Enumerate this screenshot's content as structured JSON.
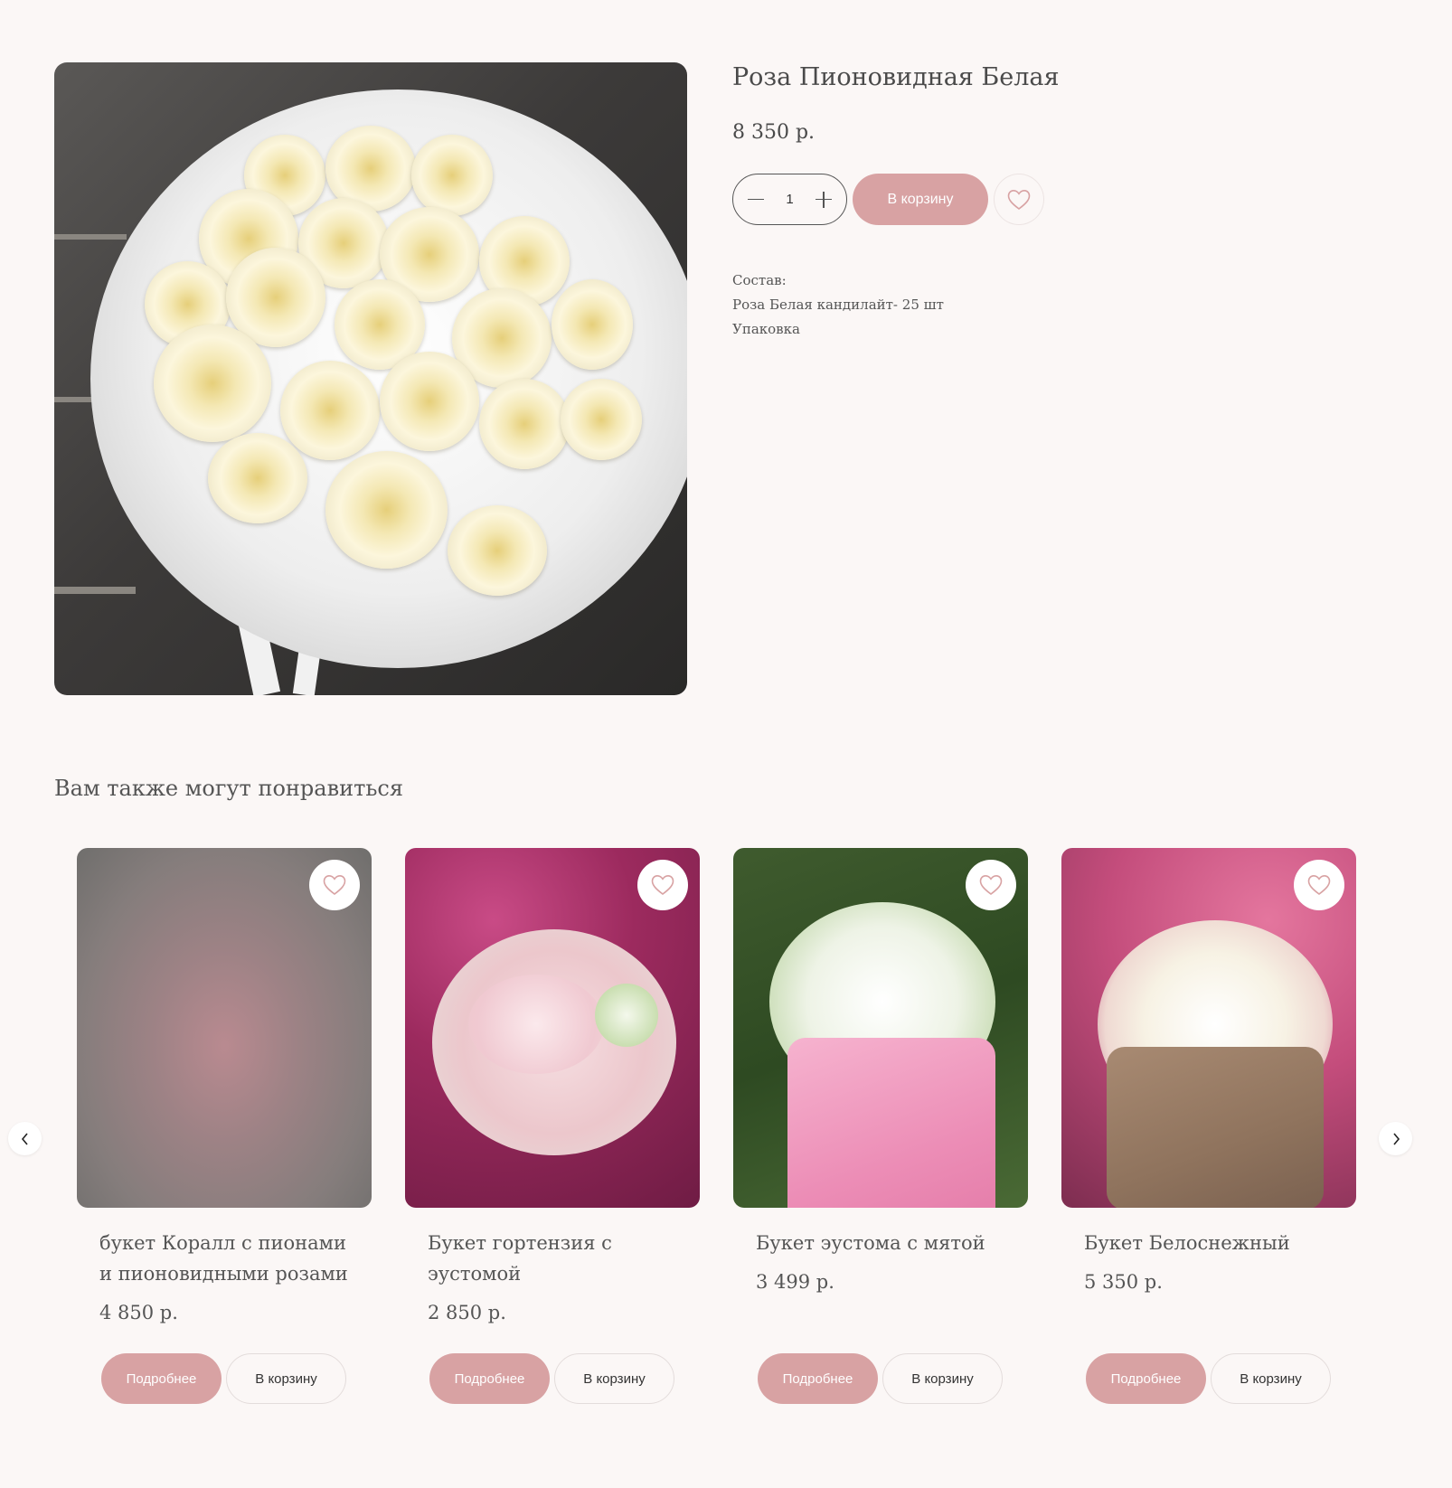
{
  "product": {
    "title": "Роза Пионовидная Белая",
    "price": "8 350 р.",
    "quantity": "1",
    "add_to_cart_label": "В корзину",
    "composition": {
      "heading": "Состав:",
      "lines": [
        "Роза Белая кандилайт- 25 шт",
        "Упаковка"
      ]
    }
  },
  "recommendations": {
    "title": "Вам также могут понравиться",
    "cards": [
      {
        "name": "букет Коралл с пионами и пионовидными розами",
        "price": "4 850 р.",
        "more_label": "Подробнее",
        "cart_label": "В корзину"
      },
      {
        "name": "Букет гортензия с эустомой",
        "price": "2 850 р.",
        "more_label": "Подробнее",
        "cart_label": "В корзину"
      },
      {
        "name": "Букет эустома с мятой",
        "price": "3 499 р.",
        "more_label": "Подробнее",
        "cart_label": "В корзину"
      },
      {
        "name": "Букет Белоснежный",
        "price": "5 350 р.",
        "more_label": "Подробнее",
        "cart_label": "В корзину"
      }
    ]
  },
  "colors": {
    "accent": "#d8a2a3",
    "background": "#fbf7f6",
    "text": "#4a4a4a"
  },
  "icons": {
    "favorite": "heart-outline-icon",
    "prev": "chevron-left-icon",
    "next": "chevron-right-icon",
    "minus": "minus-icon",
    "plus": "plus-icon"
  }
}
